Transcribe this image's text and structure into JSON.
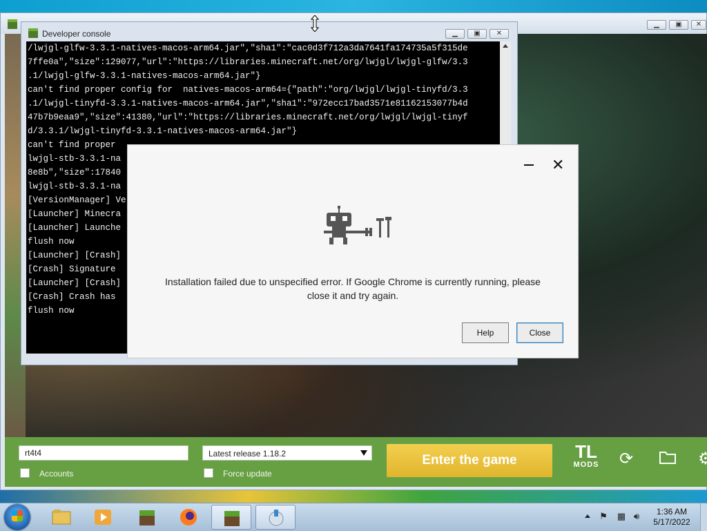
{
  "launcher": {
    "account_value": "rt4t4",
    "version_value": "Latest release 1.18.2",
    "accounts_label": "Accounts",
    "force_update_label": "Force update",
    "enter_label": "Enter the game",
    "logo_top": "TL",
    "logo_bottom": "MODS"
  },
  "console": {
    "title": "Developer console",
    "lines": [
      "/lwjgl-glfw-3.3.1-natives-macos-arm64.jar\",\"sha1\":\"cac0d3f712a3da7641fa174735a5f315de",
      "7ffe0a\",\"size\":129077,\"url\":\"https://libraries.minecraft.net/org/lwjgl/lwjgl-glfw/3.3",
      ".1/lwjgl-glfw-3.3.1-natives-macos-arm64.jar\"}",
      "can't find proper config for  natives-macos-arm64={\"path\":\"org/lwjgl/lwjgl-tinyfd/3.3",
      ".1/lwjgl-tinyfd-3.3.1-natives-macos-arm64.jar\",\"sha1\":\"972ecc17bad3571e81162153077b4d",
      "47b7b9eaa9\",\"size\":41380,\"url\":\"https://libraries.minecraft.net/org/lwjgl/lwjgl-tinyf",
      "d/3.3.1/lwjgl-tinyfd-3.3.1-natives-macos-arm64.jar\"}",
      "can't find proper",
      "lwjgl-stb-3.3.1-na",
      "8e8b\",\"size\":17840",
      "lwjgl-stb-3.3.1-na",
      "[VersionManager] Ve",
      "[Launcher] Minecra",
      "[Launcher] Launche",
      "flush now",
      "[Launcher] [Crash]",
      "[Crash] Signature",
      "[Launcher] [Crash]",
      "[Crash] Crash has",
      "flush now"
    ]
  },
  "dialog": {
    "message_line1": "Installation failed due to unspecified error. If Google Chrome is currently running, please",
    "message_line2": "close it and try again.",
    "help_label": "Help",
    "close_label": "Close",
    "close_glyph": "✕"
  },
  "taskbar": {
    "time": "1:36 AM",
    "date": "5/17/2022"
  },
  "colors": {
    "launcher_panel": "#66a043",
    "enter_button": "#e9c03a",
    "console_bg": "#000000",
    "dialog_bg": "#f6f6f6"
  },
  "icons": [
    "refresh-icon",
    "folder-icon",
    "settings-icon",
    "robot-icon",
    "tools-icon"
  ]
}
